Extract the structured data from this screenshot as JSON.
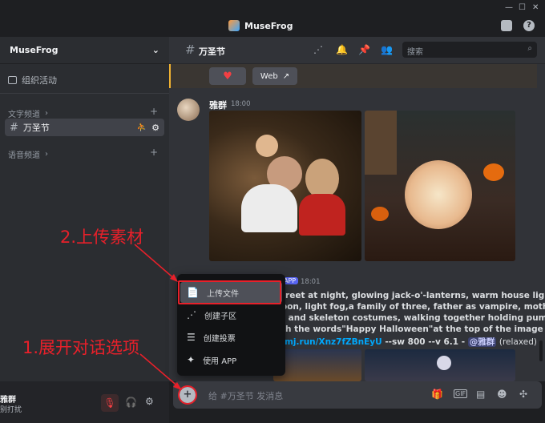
{
  "app": {
    "title": "MuseFrog"
  },
  "titlebar": {
    "icons": [
      "window-minimize-icon",
      "window-maximize-icon",
      "window-close-icon",
      "inbox-icon",
      "help-icon"
    ],
    "help_symbol": "?"
  },
  "server": {
    "name": "MuseFrog"
  },
  "sidebar": {
    "events_label": "组织活动",
    "text_category": "文字频道",
    "active_channel": "万圣节",
    "voice_category": "语音频道"
  },
  "channel_header": {
    "name": "万圣节",
    "search_placeholder": "搜索"
  },
  "prior_message": {
    "web_button": "Web"
  },
  "message1": {
    "author": "雅群",
    "time": "18:00"
  },
  "message2": {
    "badge": "APP",
    "time": "18:01",
    "lines": [
      "treet at night, glowing jack-o'-lanterns, warm house lights,",
      "oon, light fog,a family of three, father as vampire, mother",
      "t and skeleton costumes, walking together holding pumpkin",
      "th the words\"Happy Halloween\"at the top of the image --ar"
    ],
    "link_text": ".mj.run/Xnz7fZBnEyU",
    "params": "--sw 800 --v 6.1 -",
    "mention": "@雅群",
    "suffix": "(relaxed)"
  },
  "popup_menu": {
    "items": [
      {
        "label": "上传文件",
        "icon": "upload-file-icon"
      },
      {
        "label": "创建子区",
        "icon": "thread-icon"
      },
      {
        "label": "创建投票",
        "icon": "poll-icon"
      },
      {
        "label": "使用 APP",
        "icon": "app-icon"
      }
    ]
  },
  "composer": {
    "placeholder": "给 #万圣节 发消息"
  },
  "user_panel": {
    "name": "雅群",
    "status": "别打扰"
  },
  "annotations": {
    "step1": "1.展开对话选项",
    "step2": "2.上传素材",
    "accent": "#e8202a"
  }
}
